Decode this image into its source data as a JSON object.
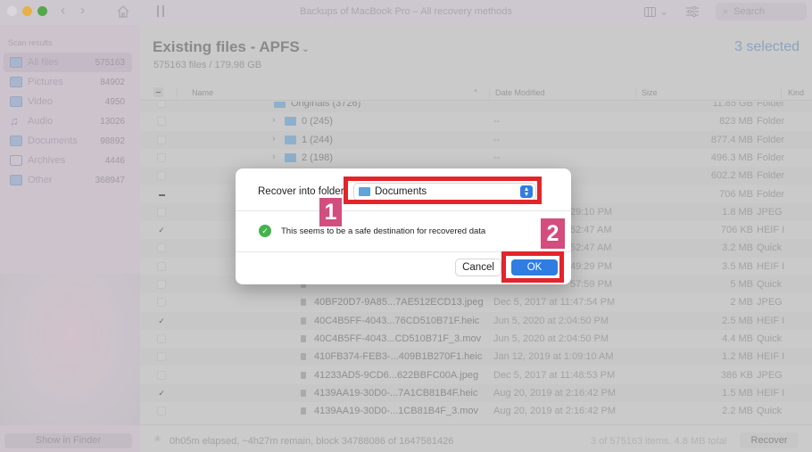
{
  "window": {
    "title": "Backups of MacBook Pro – All recovery methods",
    "search_placeholder": "Search"
  },
  "sidebar": {
    "heading": "Scan results",
    "items": [
      {
        "label": "All files",
        "count": "575163",
        "icon": "all-files-icon",
        "active": true
      },
      {
        "label": "Pictures",
        "count": "84902",
        "icon": "pictures-icon"
      },
      {
        "label": "Video",
        "count": "4950",
        "icon": "video-icon"
      },
      {
        "label": "Audio",
        "count": "13026",
        "icon": "audio-icon"
      },
      {
        "label": "Documents",
        "count": "98892",
        "icon": "documents-icon"
      },
      {
        "label": "Archives",
        "count": "4446",
        "icon": "archives-icon"
      },
      {
        "label": "Other",
        "count": "368947",
        "icon": "other-icon"
      }
    ],
    "show_in_finder": "Show in Finder"
  },
  "main": {
    "title": "Existing files - APFS",
    "title_chevron": "⌄",
    "subtitle": "575163 files / 179.98 GB",
    "selected": "3 selected",
    "columns": {
      "name": "Name",
      "date": "Date Modified",
      "size": "Size",
      "kind": "Kind"
    },
    "rows": [
      {
        "check": "none",
        "type": "folder",
        "indent": 1,
        "name": "Originals (3726)",
        "date": "",
        "size": "11.85 GB",
        "kind": "Folder",
        "partial": true
      },
      {
        "check": "none",
        "type": "folder",
        "indent": 2,
        "disclose": true,
        "name": "0 (245)",
        "date": "--",
        "size": "823 MB",
        "kind": "Folder"
      },
      {
        "check": "none",
        "type": "folder",
        "indent": 2,
        "disclose": true,
        "name": "1 (244)",
        "date": "--",
        "size": "877.4 MB",
        "kind": "Folder"
      },
      {
        "check": "none",
        "type": "folder",
        "indent": 2,
        "disclose": true,
        "name": "2 (198)",
        "date": "--",
        "size": "496.3 MB",
        "kind": "Folder"
      },
      {
        "check": "none",
        "type": "folder",
        "indent": 2,
        "name": "",
        "date": "",
        "size": "602.2 MB",
        "kind": "Folder"
      },
      {
        "check": "mixed",
        "type": "folder",
        "indent": 2,
        "name": "",
        "date": "",
        "size": "706 MB",
        "kind": "Folder"
      },
      {
        "check": "none",
        "type": "file",
        "name": "",
        "date": "29:10 PM",
        "size": "1.8 MB",
        "kind": "JPEG"
      },
      {
        "check": "on",
        "type": "file",
        "name": "",
        "date": "52:47 AM",
        "size": "706 KB",
        "kind": "HEIF I"
      },
      {
        "check": "none",
        "type": "file",
        "name": "",
        "date": "52:47 AM",
        "size": "3.2 MB",
        "kind": "Quick"
      },
      {
        "check": "none",
        "type": "file",
        "name": "",
        "date": "49:29 PM",
        "size": "3.5 MB",
        "kind": "HEIF I"
      },
      {
        "check": "none",
        "type": "file",
        "name": "",
        "date": "57:59 PM",
        "size": "5 MB",
        "kind": "Quick"
      },
      {
        "check": "none",
        "type": "file",
        "name": "40BF20D7-9A85...7AE512ECD13.jpeg",
        "date": "Dec 5, 2017 at 11:47:54 PM",
        "size": "2 MB",
        "kind": "JPEG"
      },
      {
        "check": "on",
        "type": "file",
        "name": "40C4B5FF-4043...76CD510B71F.heic",
        "date": "Jun 5, 2020 at 2:04:50 PM",
        "size": "2.5 MB",
        "kind": "HEIF I"
      },
      {
        "check": "none",
        "type": "file",
        "name": "40C4B5FF-4043...CD510B71F_3.mov",
        "date": "Jun 5, 2020 at 2:04:50 PM",
        "size": "4.4 MB",
        "kind": "Quick"
      },
      {
        "check": "none",
        "type": "file",
        "name": "410FB374-FEB3-...409B1B270F1.heic",
        "date": "Jan 12, 2019 at 1:09:10 AM",
        "size": "1.2 MB",
        "kind": "HEIF I"
      },
      {
        "check": "none",
        "type": "file",
        "name": "41233AD5-9CD6...622BBFC00A.jpeg",
        "date": "Dec 5, 2017 at 11:48:53 PM",
        "size": "386 KB",
        "kind": "JPEG"
      },
      {
        "check": "on",
        "type": "file",
        "name": "4139AA19-30D0-...7A1CB81B4F.heic",
        "date": "Aug 20, 2019 at 2:16:42 PM",
        "size": "1.5 MB",
        "kind": "HEIF I"
      },
      {
        "check": "none",
        "type": "file",
        "name": "4139AA19-30D0-...1CB81B4F_3.mov",
        "date": "Aug 20, 2019 at 2:16:42 PM",
        "size": "2.2 MB",
        "kind": "Quick"
      }
    ]
  },
  "status": {
    "progress": "0h05m elapsed, ~4h27m remain, block 34788086 of 1647581426",
    "selection_summary": "3 of 575163 items, 4.8 MB total",
    "recover_label": "Recover"
  },
  "dialog": {
    "label": "Recover into folder",
    "folder_value": "Documents",
    "safe_message": "This seems to be a safe destination for recovered data",
    "cancel_label": "Cancel",
    "ok_label": "OK"
  },
  "annotations": {
    "badge_1": "1",
    "badge_2": "2",
    "highlight_color": "#e3242b",
    "badge_color": "#d34d7e"
  }
}
